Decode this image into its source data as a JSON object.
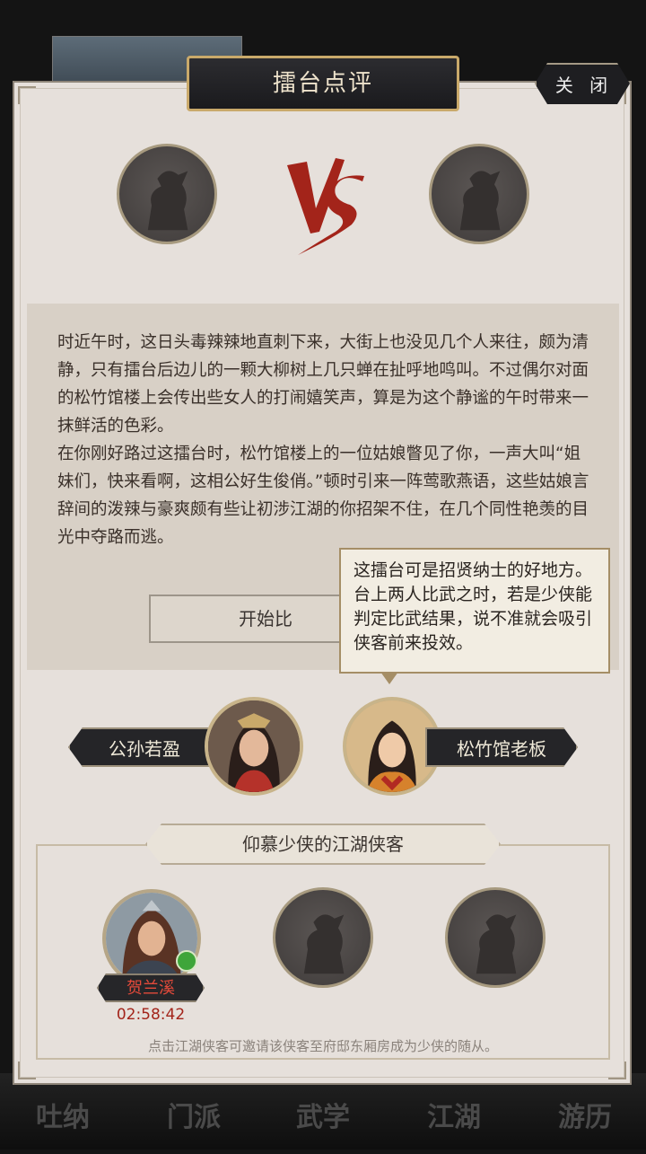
{
  "dialog": {
    "title": "擂台点评",
    "close_label": "关 闭"
  },
  "story": {
    "paragraph1": "时近午时，这日头毒辣辣地直刺下来，大街上也没见几个人来往，颇为清静，只有擂台后边儿的一颗大柳树上几只蝉在扯呼地鸣叫。不过偶尔对面的松竹馆楼上会传出些女人的打闹嬉笑声，算是为这个静谧的午时带来一抹鲜活的色彩。",
    "paragraph2": "在你刚好路过这擂台时，松竹馆楼上的一位姑娘瞥见了你，一声大叫“姐妹们，快来看啊，这相公好生俊俏。”顿时引来一阵莺歌燕语，这些姑娘言辞间的泼辣与豪爽颇有些让初涉江湖的你招架不住，在几个同性艳羡的目光中夺路而逃。"
  },
  "start_button_label": "开始比",
  "tooltip": {
    "text": "这擂台可是招贤纳士的好地方。台上两人比武之时，若是少侠能判定比武结果，说不准就会吸引侠客前来投效。"
  },
  "fighters": {
    "left_name": "公孙若盈",
    "right_name": "松竹馆老板"
  },
  "heroes": {
    "section_title": "仰慕少侠的江湖侠客",
    "items": [
      {
        "name": "贺兰溪",
        "timer": "02:58:42"
      }
    ],
    "hint": "点击江湖侠客可邀请该侠客至府邸东厢房成为少侠的随从。"
  },
  "bottom_nav": [
    "吐纳",
    "门派",
    "武学",
    "江湖",
    "游历"
  ],
  "colors": {
    "vs_red": "#a3241a",
    "panel_bg": "#e6e0db",
    "gold_border": "#c9a96a"
  }
}
